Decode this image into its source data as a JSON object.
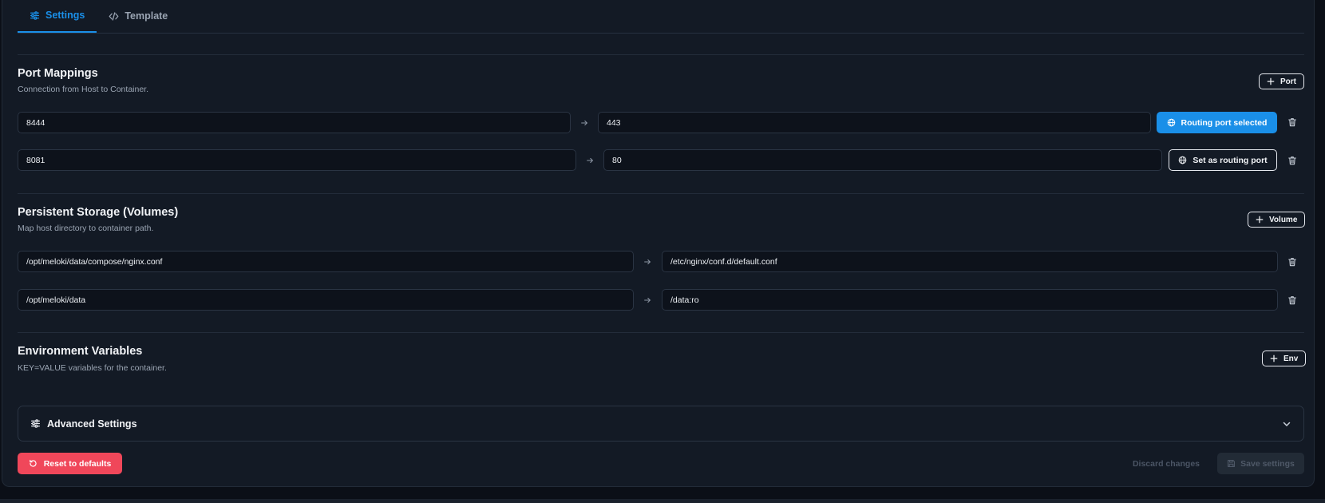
{
  "tabs": [
    {
      "label": "Settings",
      "icon": "sliders-icon",
      "active": true
    },
    {
      "label": "Template",
      "icon": "code-icon",
      "active": false
    }
  ],
  "ports": {
    "title": "Port Mappings",
    "subtitle": "Connection from Host to Container.",
    "add_label": "Port",
    "rows": [
      {
        "host": "8444",
        "container": "443",
        "routing_label": "Routing port selected",
        "selected": true
      },
      {
        "host": "8081",
        "container": "80",
        "routing_label": "Set as routing port",
        "selected": false
      }
    ]
  },
  "volumes": {
    "title": "Persistent Storage (Volumes)",
    "subtitle": "Map host directory to container path.",
    "add_label": "Volume",
    "rows": [
      {
        "host": "/opt/meloki/data/compose/nginx.conf",
        "container": "/etc/nginx/conf.d/default.conf"
      },
      {
        "host": "/opt/meloki/data",
        "container": "/data:ro"
      }
    ]
  },
  "env": {
    "title": "Environment Variables",
    "subtitle": "KEY=VALUE variables for the container.",
    "add_label": "Env"
  },
  "advanced": {
    "label": "Advanced Settings"
  },
  "footer": {
    "reset_label": "Reset to defaults",
    "discard_label": "Discard changes",
    "save_label": "Save settings"
  },
  "colors": {
    "accent": "#1a8fe8",
    "danger": "#f0475a",
    "background": "#131a25"
  }
}
